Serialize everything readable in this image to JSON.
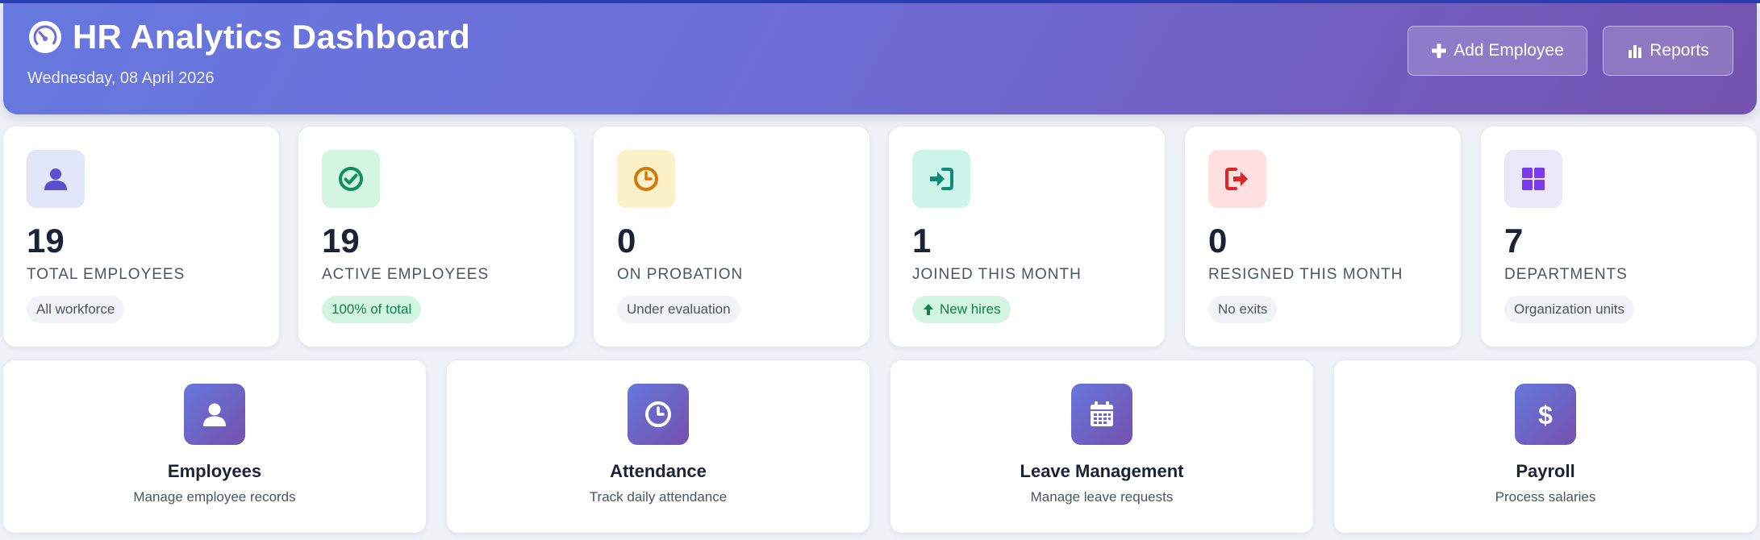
{
  "header": {
    "title": "HR Analytics Dashboard",
    "date": "Wednesday, 08 April 2026",
    "logo_icon": "dashboard-gauge-icon",
    "buttons": {
      "add_employee": "Add Employee",
      "reports": "Reports"
    }
  },
  "stats": [
    {
      "icon": "user-icon",
      "value": "19",
      "label": "TOTAL EMPLOYEES",
      "badge": "All workforce",
      "icon_bg": "#e2e6fb",
      "icon_color": "#5a4fcf"
    },
    {
      "icon": "check-circle-icon",
      "value": "19",
      "label": "ACTIVE EMPLOYEES",
      "badge": "100% of total",
      "icon_bg": "#d5f5e3",
      "icon_color": "#0f8f5b"
    },
    {
      "icon": "clock-icon",
      "value": "0",
      "label": "ON PROBATION",
      "badge": "Under evaluation",
      "icon_bg": "#fdf1c9",
      "icon_color": "#d17a06"
    },
    {
      "icon": "sign-in-icon",
      "value": "1",
      "label": "JOINED THIS MONTH",
      "badge": "New hires",
      "badge_icon": "arrow-up-icon",
      "icon_bg": "#ccf5ea",
      "icon_color": "#0f8a78"
    },
    {
      "icon": "sign-out-icon",
      "value": "0",
      "label": "RESIGNED THIS MONTH",
      "badge": "No exits",
      "icon_bg": "#fde0df",
      "icon_color": "#dc2626"
    },
    {
      "icon": "grid-icon",
      "value": "7",
      "label": "DEPARTMENTS",
      "badge": "Organization units",
      "icon_bg": "#ece8fb",
      "icon_color": "#7c3aed"
    }
  ],
  "modules": [
    {
      "icon": "user-icon",
      "title": "Employees",
      "subtitle": "Manage employee records"
    },
    {
      "icon": "clock-icon",
      "title": "Attendance",
      "subtitle": "Track daily attendance"
    },
    {
      "icon": "calendar-icon",
      "title": "Leave Management",
      "subtitle": "Manage leave requests"
    },
    {
      "icon": "dollar-icon",
      "title": "Payroll",
      "subtitle": "Process salaries"
    }
  ],
  "colors": {
    "header_gradient_start": "#6678df",
    "header_gradient_end": "#7452ae",
    "page_background": "#eef1f6",
    "badge_green_bg": "#d4f5e2",
    "badge_green_text": "#118048"
  }
}
